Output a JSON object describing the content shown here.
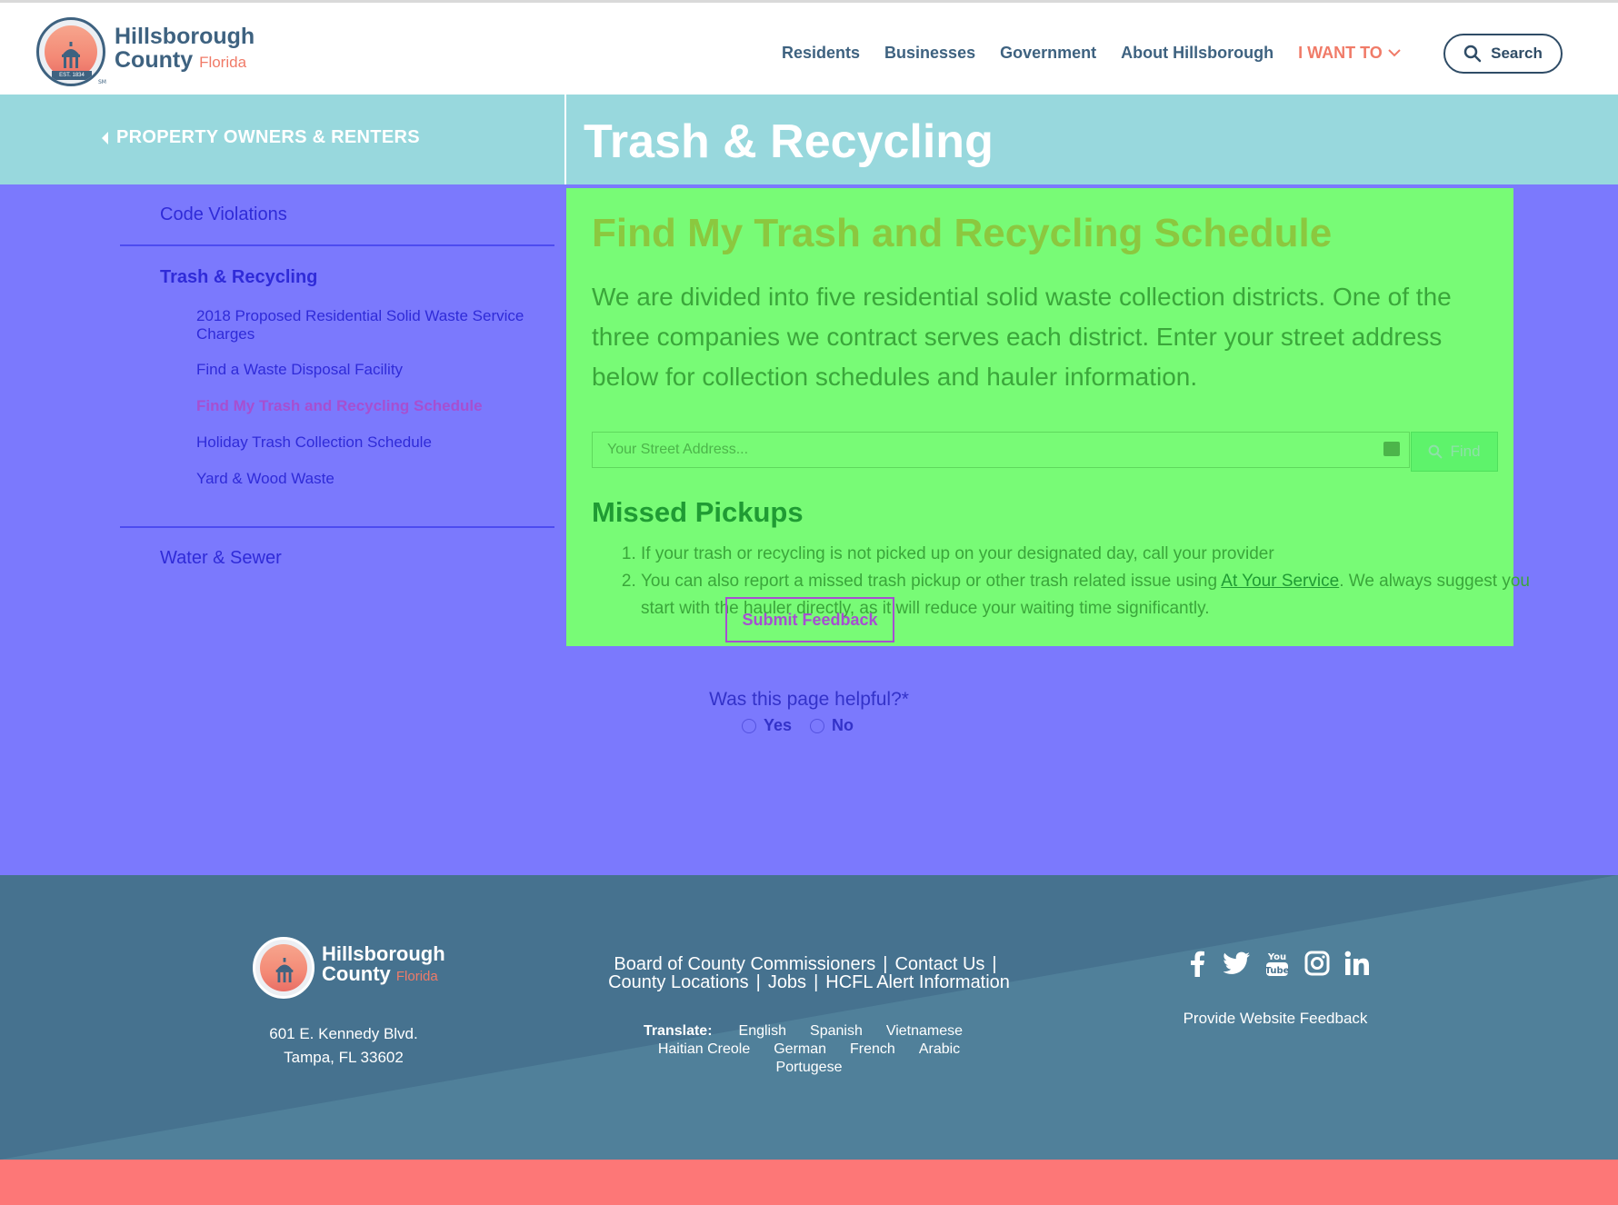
{
  "header": {
    "logo": {
      "line1": "Hillsborough",
      "line2": "County",
      "state": "Florida",
      "est": "EST. 1834",
      "tm": "SM"
    },
    "nav": [
      "Residents",
      "Businesses",
      "Government",
      "About Hillsborough"
    ],
    "want": "I WANT TO",
    "search_label": "Search"
  },
  "band": {
    "back_label": "PROPERTY OWNERS & RENTERS",
    "title": "Trash & Recycling"
  },
  "sidebar": {
    "top_item": "Code Violations",
    "current": "Trash & Recycling",
    "subitems": [
      "2018 Proposed Residential Solid Waste Service Charges",
      "Find a Waste Disposal Facility",
      "Find My Trash and Recycling Schedule",
      "Holiday Trash Collection Schedule",
      "Yard & Wood Waste"
    ],
    "active_index": 2,
    "bottom_item": "Water & Sewer"
  },
  "content": {
    "heading": "Find My Trash and Recycling Schedule",
    "intro": "We are divided into five residential solid waste collection districts. One of the three companies we contract serves each district. Enter your street address below for collection schedules and hauler information.",
    "address_placeholder": "Your Street Address...",
    "find_label": "Find",
    "missed_heading": "Missed Pickups",
    "item1": "If your trash or recycling is not picked up on your designated day, call your provider",
    "item2_before": "You can also report a missed trash pickup or other trash related issue using ",
    "item2_link": "At Your Service",
    "item2_after": ". We always suggest you start with the hauler directly, as it will reduce your waiting time significantly."
  },
  "feedback": {
    "question": "Was this page helpful?*",
    "yes": "Yes",
    "no": "No",
    "submit": "Submit Feedback"
  },
  "footer": {
    "logo": {
      "line1": "Hillsborough",
      "line2": "County",
      "state": "Florida"
    },
    "address1": "601 E. Kennedy Blvd.",
    "address2": "Tampa, FL 33602",
    "links": [
      "Board of County Commissioners",
      "Contact Us",
      "County Locations",
      "Jobs",
      "HCFL Alert Information"
    ],
    "translate_label": "Translate:",
    "languages": [
      "English",
      "Spanish",
      "Vietnamese",
      "Haitian Creole",
      "German",
      "French",
      "Arabic",
      "Portugese"
    ],
    "social": [
      "facebook-icon",
      "twitter-icon",
      "youtube-icon",
      "instagram-icon",
      "linkedin-icon"
    ],
    "website_feedback": "Provide Website Feedback"
  },
  "colors": {
    "brand_blue": "#3e6280",
    "accent_salmon": "#f07b68",
    "band": "#98d8dd",
    "main_bg": "#7b79fd",
    "content_bg": "#78fb76",
    "footer_bg": "#46728f",
    "bottom_bar": "#fd7777"
  }
}
